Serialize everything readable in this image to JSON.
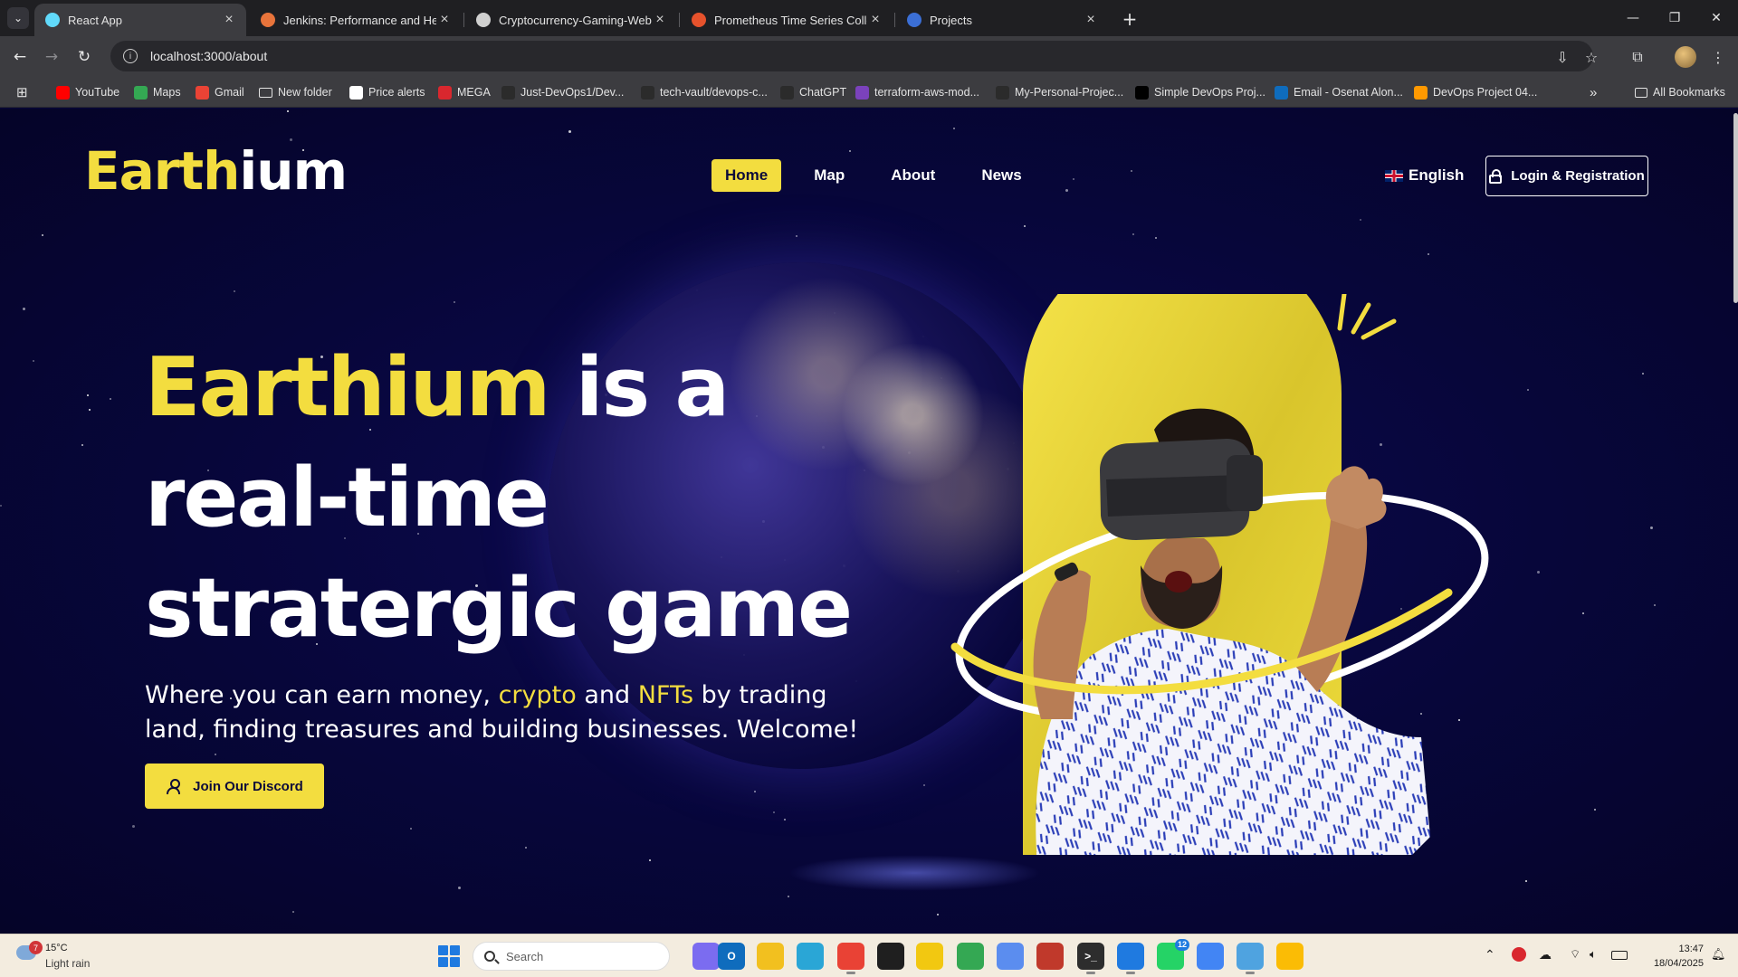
{
  "browser": {
    "tabs": [
      {
        "title": "React App",
        "active": true,
        "favicon_color": "#61dafb"
      },
      {
        "title": "Jenkins: Performance and Healt",
        "active": false,
        "favicon_color": "#e8743b"
      },
      {
        "title": "Cryptocurrency-Gaming-Websi",
        "active": false,
        "favicon_color": "#d0d0d0"
      },
      {
        "title": "Prometheus Time Series Collect",
        "active": false,
        "favicon_color": "#e6522c"
      },
      {
        "title": "Projects",
        "active": false,
        "favicon_color": "#3b6fd6"
      }
    ],
    "url": "localhost:3000/about",
    "bookmarks": [
      {
        "label": "YouTube",
        "icon": "youtube-icon",
        "color": "#ff0000"
      },
      {
        "label": "Maps",
        "icon": "maps-icon",
        "color": "#34a853"
      },
      {
        "label": "Gmail",
        "icon": "gmail-icon",
        "color": "#ea4335"
      },
      {
        "label": "New folder",
        "icon": "folder-icon",
        "color": "transparent"
      },
      {
        "label": "Price alerts",
        "icon": "price-alert-icon",
        "color": "#ffffff"
      },
      {
        "label": "MEGA",
        "icon": "mega-icon",
        "color": "#d9272e"
      },
      {
        "label": "Just-DevOps1/Dev...",
        "icon": "github-icon",
        "color": "#2b2b2b"
      },
      {
        "label": "tech-vault/devops-c...",
        "icon": "github-icon",
        "color": "#2b2b2b"
      },
      {
        "label": "ChatGPT",
        "icon": "chatgpt-icon",
        "color": "#2b2b2b"
      },
      {
        "label": "terraform-aws-mod...",
        "icon": "terraform-icon",
        "color": "#7b42bc"
      },
      {
        "label": "My-Personal-Projec...",
        "icon": "github-icon",
        "color": "#2b2b2b"
      },
      {
        "label": "Simple DevOps Proj...",
        "icon": "medium-icon",
        "color": "#000000"
      },
      {
        "label": "Email - Osenat Alon...",
        "icon": "outlook-icon",
        "color": "#0f6cbd"
      },
      {
        "label": "DevOps Project 04...",
        "icon": "aws-icon",
        "color": "#ff9900"
      }
    ],
    "all_bookmarks": "All Bookmarks"
  },
  "site": {
    "logo_highlight": "Earth",
    "logo_rest": "ium",
    "nav": [
      {
        "label": "Home",
        "active": true
      },
      {
        "label": "Map",
        "active": false
      },
      {
        "label": "About",
        "active": false
      },
      {
        "label": "News",
        "active": false
      }
    ],
    "language": "English",
    "login_label": "Login & Registration",
    "headline_highlight": "Earthium",
    "headline_rest": " is a real-time stratergic game",
    "sub_part1": "Where you can earn money, ",
    "sub_crypto": "crypto",
    "sub_part2": " and ",
    "sub_nfts": "NFTs",
    "sub_part3": " by trading land, finding treasures and building businesses. Welcome!",
    "cta_label": "Join Our Discord",
    "accent_color": "#f3dd3f",
    "background_color": "#07063a"
  },
  "taskbar": {
    "weather_temp": "15°C",
    "weather_desc": "Light rain",
    "weather_badge": "7",
    "search_placeholder": "Search",
    "whatsapp_badge": "12",
    "time": "13:47",
    "date": "18/04/2025"
  }
}
